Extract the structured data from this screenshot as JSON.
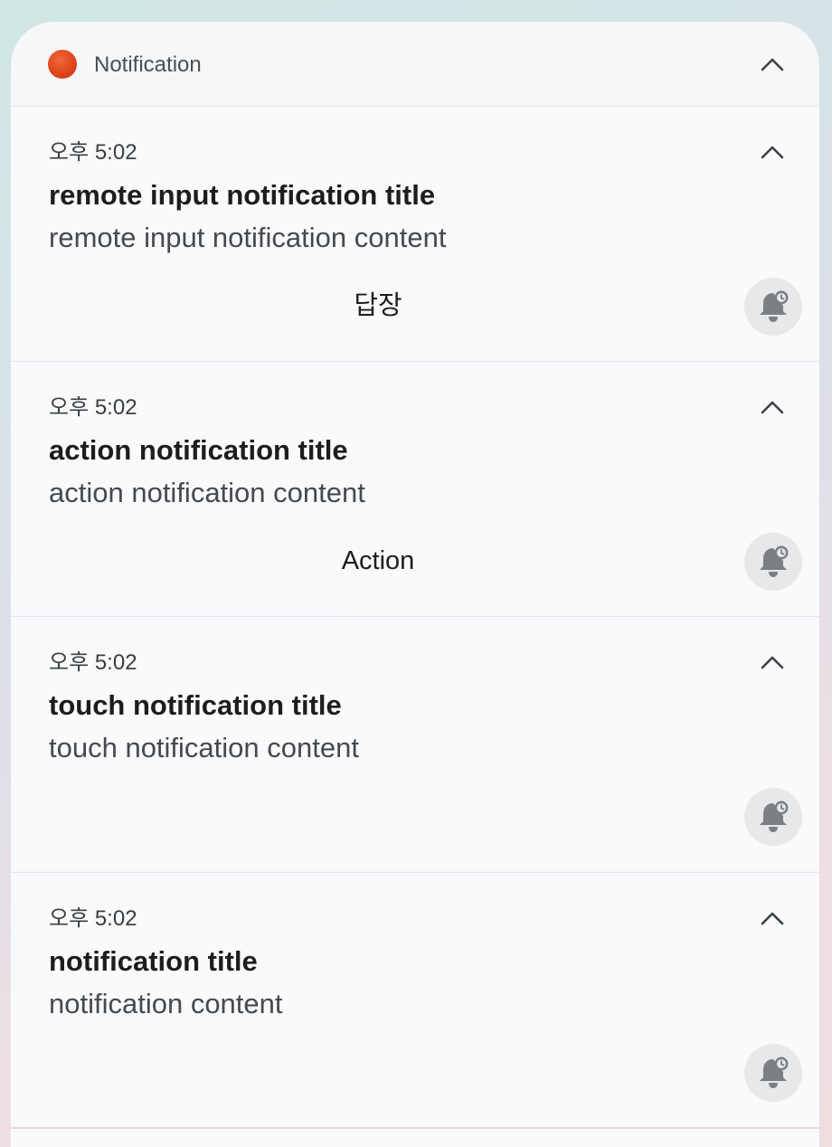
{
  "group": {
    "app_name": "Notification",
    "app_icon": "app-icon-orange-dot",
    "collapse_icon": "chevron-up-icon"
  },
  "notifications": [
    {
      "time": "오후 5:02",
      "title": "remote input notification title",
      "content": "remote input notification content",
      "action_label": "답장"
    },
    {
      "time": "오후 5:02",
      "title": "action notification title",
      "content": "action notification content",
      "action_label": "Action"
    },
    {
      "time": "오후 5:02",
      "title": "touch notification title",
      "content": "touch notification content"
    },
    {
      "time": "오후 5:02",
      "title": "notification title",
      "content": "notification content"
    }
  ],
  "icons": {
    "snooze": "snooze-bell-icon",
    "expand": "chevron-up-icon"
  },
  "colors": {
    "app_icon": "#e0451b",
    "accent_text": "#1c1d1f"
  }
}
